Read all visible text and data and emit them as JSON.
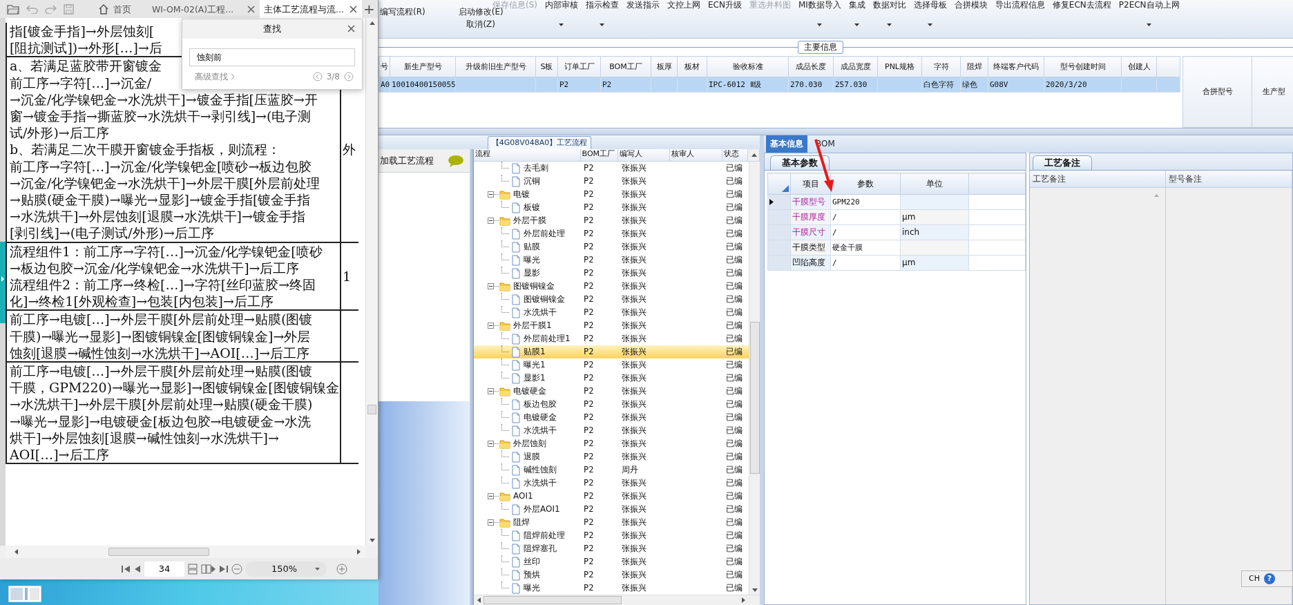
{
  "doc_window": {
    "tabs": [
      {
        "label": "首页",
        "kind": "home",
        "selected": false
      },
      {
        "label": "WI-OM-02(A)工程...",
        "kind": "file",
        "selected": false
      },
      {
        "label": "主体工艺流程与流...",
        "kind": "file",
        "selected": true
      }
    ],
    "new_tab": "+",
    "document": {
      "rows": [
        {
          "lines": [
            "指[镀金手指]→外层蚀刻[",
            "[阻抗测试])→外形[…]→后"
          ]
        },
        {
          "lines": [
            "a、若满足蓝胶带开窗镀金",
            "前工序→字符[…]→沉金/",
            "→沉金/化学镍钯金→水洗烘干]→镀金手指[压蓝胶→开",
            "窗→镀金手指→撕蓝胶→水洗烘干→剥引线]→(电子测",
            "试/外形)→后工序",
            "b、若满足二次干膜开窗镀金手指板，则流程：",
            "前工序→字符[…]→沉金/化学镍钯金[喷砂→板边包胶",
            "→沉金/化学镍钯金→水洗烘干]→外层干膜[外层前处理",
            "→贴膜(硬金干膜)→曝光→显影]→镀金手指[镀金手指",
            "→水洗烘干]→外层蚀刻[退膜→水洗烘干]→镀金手指",
            "[剥引线]→(电子测试/外形)→后工序"
          ],
          "side": "外"
        },
        {
          "lines": [
            "流程组件1：前工序→字符[…]→沉金/化学镍钯金[喷砂",
            "→板边包胶→沉金/化学镍钯金→水洗烘干]→后工序",
            "流程组件2：前工序→终检[…]→字符[丝印蓝胶→终固",
            "化]→终检1[外观检查]→包装[内包装]→后工序"
          ],
          "side": "1"
        },
        {
          "lines": [
            "前工序→电镀[…]→外层干膜[外层前处理→贴膜(图镀",
            "干膜)→曝光→显影]→图镀铜镍金[图镀铜镍金]→外层",
            "蚀刻[退膜→碱性蚀刻→水洗烘干]→AOI[…]→后工序"
          ]
        },
        {
          "lines": [
            "前工序→电镀[…]→外层干膜[外层前处理→贴膜(图镀",
            "干膜，GPM220)→曝光→显影]→图镀铜镍金[图镀铜镍金",
            "→水洗烘干]→外层干膜[外层前处理→贴膜(硬金干膜)",
            "→曝光→显影]→电镀硬金[板边包胶→电镀硬金→水洗",
            "烘干]→外层蚀刻[退膜→碱性蚀刻→水洗烘干]→",
            "AOI[…]→后工序"
          ]
        }
      ]
    },
    "find_dialog": {
      "title": "查找",
      "query": "蚀刻前",
      "advanced": "高级查找",
      "count": "3/8"
    },
    "page": "34",
    "zoom": "150%"
  },
  "app": {
    "toolbar": {
      "primary": [
        {
          "label": "编写流程(R)"
        },
        {
          "label": "启动修改(E)"
        },
        {
          "label": "取消(Z)"
        }
      ],
      "items": [
        {
          "label": "保存信息(S)",
          "dropdown": false,
          "disabled": true
        },
        {
          "label": "内部审核",
          "dropdown": true,
          "disabled": false
        },
        {
          "label": "指示检查",
          "dropdown": true,
          "disabled": false
        },
        {
          "label": "发送指示",
          "dropdown": false,
          "disabled": false
        },
        {
          "label": "文控上网",
          "dropdown": false,
          "disabled": false
        },
        {
          "label": "ECN升级",
          "dropdown": false,
          "disabled": false
        },
        {
          "label": "重选井料图",
          "dropdown": false,
          "disabled": true
        },
        {
          "label": "MI数据导入",
          "dropdown": true,
          "disabled": false
        },
        {
          "label": "集成",
          "dropdown": true,
          "disabled": false
        },
        {
          "label": "数据对比",
          "dropdown": true,
          "disabled": false
        },
        {
          "label": "选择母板",
          "dropdown": true,
          "disabled": false
        },
        {
          "label": "合拼模块",
          "dropdown": false,
          "disabled": false
        },
        {
          "label": "导出流程信息",
          "dropdown": false,
          "disabled": false
        },
        {
          "label": "修复ECN去流程",
          "dropdown": false,
          "disabled": false
        },
        {
          "label": "P2ECN自动上网",
          "dropdown": true,
          "disabled": false
        }
      ]
    },
    "main_info": {
      "title": "主要信息",
      "columns": [
        "号",
        "新生产型号",
        "升级前旧生产型号",
        "S板",
        "订单工厂",
        "BOM工厂",
        "板厚",
        "板材",
        "验收标准",
        "成品长度",
        "成品宽度",
        "PNL规格",
        "字符",
        "阻焊",
        "终端客户代码",
        "型号创建时间",
        "创建人"
      ],
      "rows": [
        {
          "selected": true,
          "cells": [
            "A0",
            "10010400150055",
            null,
            null,
            "P2",
            "P2",
            null,
            null,
            "IPC-6012 Ⅱ级",
            "270.030",
            "257.030",
            null,
            "白色字符",
            "绿色",
            "G08V",
            "2020/3/20",
            null
          ]
        }
      ],
      "side_columns": [
        "合拼型号",
        "生产型"
      ]
    },
    "process": {
      "title": "【4G08V048A0】工艺流程",
      "loader": "加载工艺流程",
      "columns": [
        "流程",
        "BOM工厂",
        "编写人",
        "核审人",
        "状态"
      ],
      "rows": [
        {
          "kind": "group",
          "children": [
            {
              "kind": "step",
              "name": "去毛刺",
              "bom": "P2",
              "author": "张振兴",
              "status": "已编",
              "selected": false
            },
            {
              "kind": "step",
              "name": "沉铜",
              "bom": "P2",
              "author": "张振兴",
              "status": "已编",
              "selected": false
            }
          ]
        },
        {
          "kind": "folder",
          "name": "电镀",
          "bom": "P2",
          "author": "张振兴",
          "status": "已编",
          "selected": false,
          "expanded": true,
          "children": [
            {
              "kind": "step",
              "name": "板镀",
              "bom": "P2",
              "author": "张振兴",
              "status": "已编",
              "selected": false
            }
          ]
        },
        {
          "kind": "folder",
          "name": "外层干膜",
          "bom": "P2",
          "author": "张振兴",
          "status": "已编",
          "selected": false,
          "expanded": true,
          "children": [
            {
              "kind": "step",
              "name": "外层前处理",
              "bom": "P2",
              "author": "张振兴",
              "status": "已编",
              "selected": false
            },
            {
              "kind": "step",
              "name": "贴膜",
              "bom": "P2",
              "author": "张振兴",
              "status": "已编",
              "selected": false
            },
            {
              "kind": "step",
              "name": "曝光",
              "bom": "P2",
              "author": "张振兴",
              "status": "已编",
              "selected": false
            },
            {
              "kind": "step",
              "name": "显影",
              "bom": "P2",
              "author": "张振兴",
              "status": "已编",
              "selected": false
            }
          ]
        },
        {
          "kind": "folder",
          "name": "图镀铜镍金",
          "bom": "P2",
          "author": "张振兴",
          "status": "已编",
          "selected": false,
          "expanded": true,
          "children": [
            {
              "kind": "step",
              "name": "图镀铜镍金",
              "bom": "P2",
              "author": "张振兴",
              "status": "已编",
              "selected": false
            },
            {
              "kind": "step",
              "name": "水洗烘干",
              "bom": "P2",
              "author": "张振兴",
              "status": "已编",
              "selected": false
            }
          ]
        },
        {
          "kind": "folder",
          "name": "外层干膜1",
          "bom": "P2",
          "author": "张振兴",
          "status": "已编",
          "selected": false,
          "expanded": true,
          "children": [
            {
              "kind": "step",
              "name": "外层前处理1",
              "bom": "P2",
              "author": "张振兴",
              "status": "已编",
              "selected": false
            },
            {
              "kind": "step",
              "name": "贴膜1",
              "bom": "P2",
              "author": "张振兴",
              "status": "已编",
              "selected": true
            },
            {
              "kind": "step",
              "name": "曝光1",
              "bom": "P2",
              "author": "张振兴",
              "status": "已编",
              "selected": false
            },
            {
              "kind": "step",
              "name": "显影1",
              "bom": "P2",
              "author": "张振兴",
              "status": "已编",
              "selected": false
            }
          ]
        },
        {
          "kind": "folder",
          "name": "电镀硬金",
          "bom": "P2",
          "author": "张振兴",
          "status": "已编",
          "selected": false,
          "expanded": true,
          "children": [
            {
              "kind": "step",
              "name": "板边包胶",
              "bom": "P2",
              "author": "张振兴",
              "status": "已编",
              "selected": false
            },
            {
              "kind": "step",
              "name": "电镀硬金",
              "bom": "P2",
              "author": "张振兴",
              "status": "已编",
              "selected": false
            },
            {
              "kind": "step",
              "name": "水洗烘干",
              "bom": "P2",
              "author": "张振兴",
              "status": "已编",
              "selected": false
            }
          ]
        },
        {
          "kind": "folder",
          "name": "外层蚀刻",
          "bom": "P2",
          "author": "张振兴",
          "status": "已编",
          "selected": false,
          "expanded": true,
          "children": [
            {
              "kind": "step",
              "name": "退膜",
              "bom": "P2",
              "author": "张振兴",
              "status": "已编",
              "selected": false
            },
            {
              "kind": "step",
              "name": "碱性蚀刻",
              "bom": "P2",
              "author": "周丹",
              "status": "已编",
              "selected": false
            },
            {
              "kind": "step",
              "name": "水洗烘干",
              "bom": "P2",
              "author": "张振兴",
              "status": "已编",
              "selected": false
            }
          ]
        },
        {
          "kind": "folder",
          "name": "AOI1",
          "bom": "P2",
          "author": "张振兴",
          "status": "已编",
          "selected": false,
          "expanded": true,
          "children": [
            {
              "kind": "step",
              "name": "外层AOI1",
              "bom": "P2",
              "author": "张振兴",
              "status": "已编",
              "selected": false
            }
          ]
        },
        {
          "kind": "folder",
          "name": "阻焊",
          "bom": "P2",
          "author": "张振兴",
          "status": "已编",
          "selected": false,
          "expanded": true,
          "children": [
            {
              "kind": "step",
              "name": "阻焊前处理",
              "bom": "P2",
              "author": "张振兴",
              "status": "已编",
              "selected": false
            },
            {
              "kind": "step",
              "name": "阻焊塞孔",
              "bom": "P2",
              "author": "张振兴",
              "status": "已编",
              "selected": false
            },
            {
              "kind": "step",
              "name": "丝印",
              "bom": "P2",
              "author": "张振兴",
              "status": "已编",
              "selected": false
            },
            {
              "kind": "step",
              "name": "预烘",
              "bom": "P2",
              "author": "张振兴",
              "status": "已编",
              "selected": false
            },
            {
              "kind": "step",
              "name": "曝光",
              "bom": "P2",
              "author": "张振兴",
              "status": "已编",
              "selected": false
            }
          ]
        }
      ]
    },
    "detail": {
      "tabs": [
        {
          "label": "基本信息",
          "selected": true
        },
        {
          "label": "BOM",
          "selected": false
        }
      ],
      "param_tab": "基本参数",
      "param_columns": [
        "项目",
        "参数",
        "单位"
      ],
      "params": [
        {
          "item": "干膜型号",
          "value": "GPM220",
          "highlighted": true,
          "selected": true
        },
        {
          "item": "干膜厚度",
          "value": "/",
          "unit": "μm",
          "highlighted": true,
          "selected": false
        },
        {
          "item": "干膜尺寸",
          "value": "/",
          "unit": "inch",
          "highlighted": true,
          "selected": false
        },
        {
          "item": "干膜类型",
          "value": "硬金干膜",
          "highlighted": false,
          "selected": false
        },
        {
          "item": "凹陷高度",
          "value": "/",
          "unit": "μm",
          "highlighted": false,
          "selected": false
        }
      ],
      "notes_tab": "工艺备注",
      "notes_columns": [
        "工艺备注",
        "型号备注"
      ]
    }
  },
  "language_bar": {
    "label": "CH",
    "help": "?"
  }
}
